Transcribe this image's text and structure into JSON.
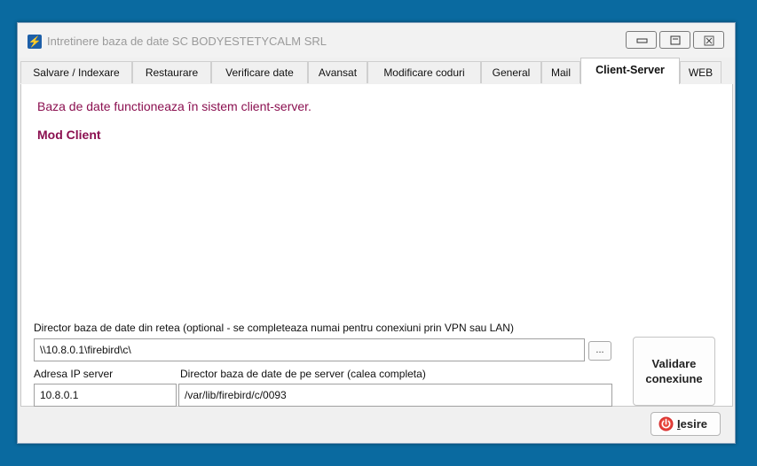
{
  "window": {
    "title": "Intretinere baza de date SC BODYESTETYCALM SRL",
    "icon": "lightning-icon"
  },
  "tabs": [
    {
      "label": "Salvare / Indexare"
    },
    {
      "label": "Restaurare"
    },
    {
      "label": "Verificare date"
    },
    {
      "label": "Avansat"
    },
    {
      "label": "Modificare coduri"
    },
    {
      "label": "General"
    },
    {
      "label": "Mail"
    },
    {
      "label": "Client-Server",
      "active": true
    },
    {
      "label": "WEB"
    }
  ],
  "panel": {
    "message": "Baza de date functioneaza în sistem client-server.",
    "mode": "Mod Client",
    "network_dir_label": "Director baza de date din retea (optional - se completeaza numai pentru conexiuni prin VPN sau LAN)",
    "network_dir_value": "\\\\10.8.0.1\\firebird\\c\\",
    "browse_label": "...",
    "ip_label": "Adresa IP server",
    "ip_value": "10.8.0.1",
    "server_dir_label": "Director baza de date de pe server (calea completa)",
    "server_dir_value": "/var/lib/firebird/c/0093",
    "validate_label_1": "Validare",
    "validate_label_2": "conexiune"
  },
  "footer": {
    "exit_first_letter": "I",
    "exit_rest": "esire",
    "exit_icon": "power-icon"
  },
  "colors": {
    "desktop": "#0a6aa0",
    "message_text": "#8b1050",
    "exit_icon": "#d9302f"
  }
}
